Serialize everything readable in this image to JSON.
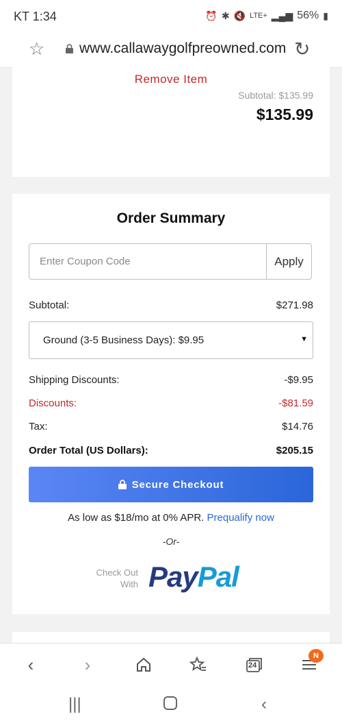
{
  "status_bar": {
    "time": "KT 1:34",
    "lte": "LTE+",
    "battery": "56%"
  },
  "browser": {
    "url": "www.callawaygolfpreowned.com",
    "icons": [
      "star-icon",
      "lock-icon",
      "reload-icon"
    ]
  },
  "cart_item": {
    "remove_label": "Remove Item",
    "subtotal_small": "Subtotal: $135.99",
    "subtotal_big": "$135.99"
  },
  "order_summary": {
    "title": "Order Summary",
    "coupon_placeholder": "Enter Coupon Code",
    "apply_label": "Apply",
    "subtotal_label": "Subtotal:",
    "subtotal_value": "$271.98",
    "shipping_selected": "Ground (3-5 Business Days): $9.95",
    "shipping_discounts_label": "Shipping Discounts:",
    "shipping_discounts_value": "-$9.95",
    "discounts_label": "Discounts:",
    "discounts_value": "-$81.59",
    "tax_label": "Tax:",
    "tax_value": "$14.76",
    "total_label": "Order Total (US Dollars):",
    "total_value": "$205.15",
    "checkout_label": "Secure Checkout",
    "finance_text": "As low as $18/mo at 0% APR.",
    "finance_link": "Prequalify now",
    "or_text": "-Or-",
    "paypal_checkout_line1": "Check Out",
    "paypal_checkout_line2": "With",
    "paypal_part1": "Pay",
    "paypal_part2": "Pal"
  },
  "bottom_nav": {
    "tabs_count": "24",
    "menu_badge": "N"
  },
  "colors": {
    "accent_blue": "#2a66d9",
    "discount_red": "#c62828",
    "paypal_dark": "#253b80",
    "paypal_light": "#179bd7",
    "badge_orange": "#f26a1b"
  }
}
